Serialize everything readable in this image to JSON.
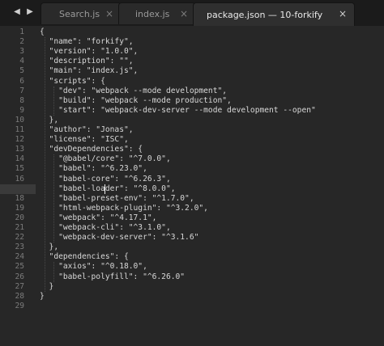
{
  "navigation": {
    "left_arrow": "◀",
    "right_arrow": "▶"
  },
  "tabs": [
    {
      "label": "Search.js",
      "active": false,
      "close": "×"
    },
    {
      "label": "index.js",
      "active": false,
      "close": "×"
    },
    {
      "label": "package.json — 10-forkify",
      "active": true,
      "close": "×"
    }
  ],
  "editor": {
    "active_line": 17,
    "lines": [
      "{",
      "  \"name\": \"forkify\",",
      "  \"version\": \"1.0.0\",",
      "  \"description\": \"\",",
      "  \"main\": \"index.js\",",
      "  \"scripts\": {",
      "    \"dev\": \"webpack --mode development\",",
      "    \"build\": \"webpack --mode production\",",
      "    \"start\": \"webpack-dev-server --mode development --open\"",
      "  },",
      "  \"author\": \"Jonas\",",
      "  \"license\": \"ISC\",",
      "  \"devDependencies\": {",
      "    \"@babel/core\": \"^7.0.0\",",
      "    \"babel\": \"^6.23.0\",",
      "    \"babel-core\": \"^6.26.3\",",
      "    \"babel-loader\": \"^8.0.0\",",
      "    \"babel-preset-env\": \"^1.7.0\",",
      "    \"html-webpack-plugin\": \"^3.2.0\",",
      "    \"webpack\": \"^4.17.1\",",
      "    \"webpack-cli\": \"^3.1.0\",",
      "    \"webpack-dev-server\": \"^3.1.6\"",
      "  },",
      "  \"dependencies\": {",
      "    \"axios\": \"^0.18.0\",",
      "    \"babel-polyfill\": \"^6.26.0\"",
      "  }",
      "}",
      ""
    ]
  },
  "colors": {
    "background": "#272727",
    "tab_bar": "#1b1b1b",
    "text": "#d8d8d8",
    "line_number": "#7b7b7b",
    "active_line_highlight": "#3a3a3a"
  }
}
